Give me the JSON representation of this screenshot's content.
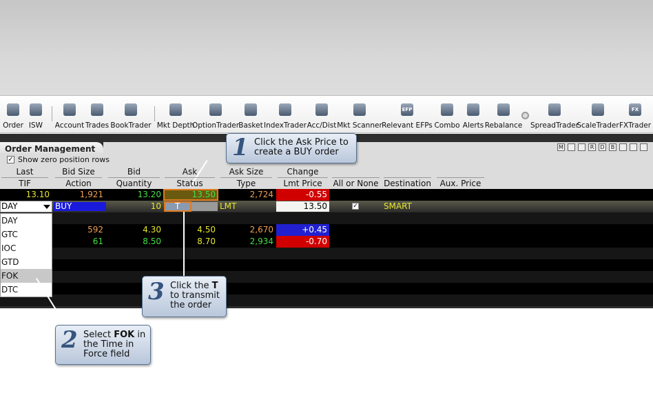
{
  "toolbar": {
    "items": [
      {
        "label": "Order",
        "icon": "order-icon"
      },
      {
        "label": "ISW",
        "icon": "isw-icon"
      },
      {
        "label": "Account",
        "icon": "account-icon"
      },
      {
        "label": "Trades",
        "icon": "trades-icon"
      },
      {
        "label": "BookTrader",
        "icon": "booktrader-icon"
      },
      {
        "label": "Mkt Depth",
        "icon": "mkt-depth-icon"
      },
      {
        "label": "OptionTrader",
        "icon": "optiontrader-icon"
      },
      {
        "label": "Basket",
        "icon": "basket-icon"
      },
      {
        "label": "IndexTrader",
        "icon": "indextrader-icon"
      },
      {
        "label": "Acc/Dist",
        "icon": "acc-dist-icon"
      },
      {
        "label": "Mkt Scanner",
        "icon": "mkt-scanner-icon"
      },
      {
        "label": "Relevant EFPs",
        "icon": "efp-icon",
        "icon_text": "EFP"
      },
      {
        "label": "Combo",
        "icon": "combo-icon"
      },
      {
        "label": "Alerts",
        "icon": "alerts-icon"
      },
      {
        "label": "Rebalance",
        "icon": "rebalance-icon"
      },
      {
        "label": "SpreadTrader",
        "icon": "spreadtrader-icon"
      },
      {
        "label": "ScaleTrader",
        "icon": "scaletrader-icon"
      },
      {
        "label": "FXTrader",
        "icon": "fxtrader-icon",
        "icon_text": "FX"
      }
    ]
  },
  "order_management": {
    "title": "Order Management",
    "show_zero_label": "Show zero position rows",
    "show_zero_checked": true,
    "window_icons": [
      "M",
      "",
      "",
      "R",
      "D",
      "B",
      "",
      "",
      ""
    ],
    "headers_top": [
      "Last",
      "Bid Size",
      "Bid",
      "Ask",
      "Ask Size",
      "Change"
    ],
    "headers_bottom": [
      "TIF",
      "Action",
      "Quantity",
      "Status",
      "Type",
      "Lmt Price",
      "All or None",
      "Destination",
      "Aux. Price"
    ]
  },
  "rows": {
    "r1": {
      "last": "13.10",
      "bid_size": "1,921",
      "bid": "13.20",
      "ask": "13.50",
      "ask_size": "2,724",
      "change": "-0.55"
    },
    "order": {
      "tif": "DAY",
      "action": "BUY",
      "quantity": "10",
      "status": "T",
      "type": "LMT",
      "lmt_price": "13.50",
      "all_or_none": "✓",
      "destination": "SMART"
    },
    "r3": {
      "bid_size": "592",
      "bid": "4.30",
      "ask": "4.50",
      "ask_size": "2,670",
      "change": "+0.45"
    },
    "r4": {
      "bid_size": "61",
      "bid": "8.50",
      "ask": "8.70",
      "ask_size": "2,934",
      "change": "-0.70"
    }
  },
  "tif_options": [
    "DAY",
    "GTC",
    "IOC",
    "GTD",
    "FOK",
    "DTC"
  ],
  "tif_selected": "FOK",
  "callouts": {
    "c1": {
      "num": "1",
      "line1": "Click the Ask Price to",
      "line2": "create a BUY order"
    },
    "c2": {
      "num": "2",
      "line1_pre": "Select ",
      "line1_bold": "FOK",
      "line1_post": " in",
      "line2": "the Time in",
      "line3": "Force field"
    },
    "c3": {
      "num": "3",
      "line1_pre": "Click the ",
      "line1_bold": "T",
      "line2": "to transmit",
      "line3": "the order"
    }
  },
  "colors": {
    "change_negative_bg": "#d00000",
    "change_positive_bg": "#2020d0",
    "buy_bg": "#1a1adc",
    "value_yellow": "#e6e62e",
    "value_green": "#44e044",
    "value_orange": "#f0a050"
  }
}
